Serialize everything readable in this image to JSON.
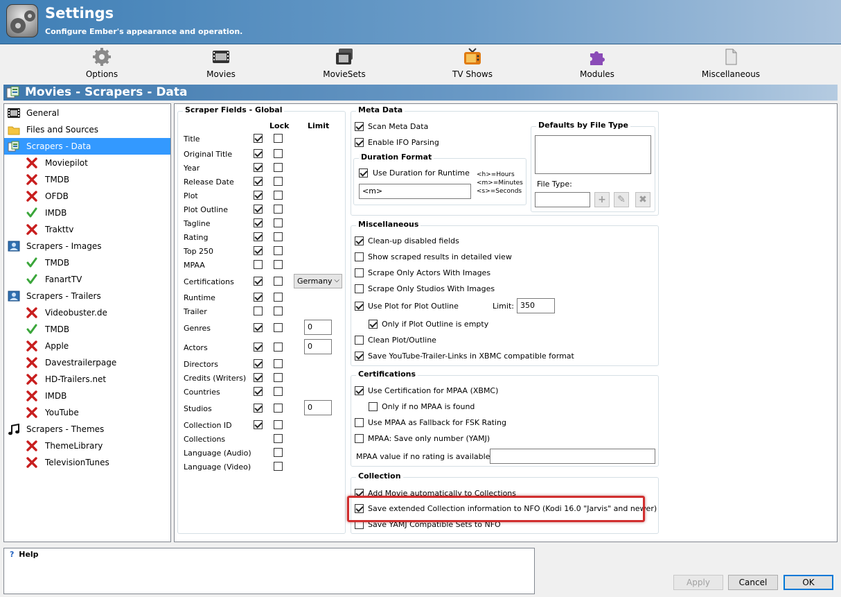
{
  "header": {
    "title": "Settings",
    "subtitle": "Configure Ember's appearance and operation."
  },
  "toolbar": {
    "buttons": [
      {
        "label": "Options",
        "icon": "gear-icon"
      },
      {
        "label": "Movies",
        "icon": "film-icon"
      },
      {
        "label": "MovieSets",
        "icon": "film-stack-icon"
      },
      {
        "label": "TV Shows",
        "icon": "tv-icon"
      },
      {
        "label": "Modules",
        "icon": "puzzle-icon"
      },
      {
        "label": "Miscellaneous",
        "icon": "document-icon"
      }
    ]
  },
  "section": {
    "title": "Movies - Scrapers - Data"
  },
  "tree": {
    "items": [
      {
        "label": "General",
        "icon": "film-icon",
        "indent": 0
      },
      {
        "label": "Files and Sources",
        "icon": "folder-icon",
        "indent": 0
      },
      {
        "label": "Scrapers - Data",
        "icon": "data-scraper-icon",
        "indent": 0,
        "selected": true
      },
      {
        "label": "Moviepilot",
        "icon": "disabled-x-icon",
        "indent": 1
      },
      {
        "label": "TMDB",
        "icon": "disabled-x-icon",
        "indent": 1
      },
      {
        "label": "OFDB",
        "icon": "disabled-x-icon",
        "indent": 1
      },
      {
        "label": "IMDB",
        "icon": "enabled-check-icon",
        "indent": 1
      },
      {
        "label": "Trakttv",
        "icon": "disabled-x-icon",
        "indent": 1
      },
      {
        "label": "Scrapers - Images",
        "icon": "image-scraper-icon",
        "indent": 0
      },
      {
        "label": "TMDB",
        "icon": "enabled-check-icon",
        "indent": 1
      },
      {
        "label": "FanartTV",
        "icon": "enabled-check-icon",
        "indent": 1
      },
      {
        "label": "Scrapers - Trailers",
        "icon": "image-scraper-icon",
        "indent": 0
      },
      {
        "label": "Videobuster.de",
        "icon": "disabled-x-icon",
        "indent": 1
      },
      {
        "label": "TMDB",
        "icon": "enabled-check-icon",
        "indent": 1
      },
      {
        "label": "Apple",
        "icon": "disabled-x-icon",
        "indent": 1
      },
      {
        "label": "Davestrailerpage",
        "icon": "disabled-x-icon",
        "indent": 1
      },
      {
        "label": "HD-Trailers.net",
        "icon": "disabled-x-icon",
        "indent": 1
      },
      {
        "label": "IMDB",
        "icon": "disabled-x-icon",
        "indent": 1
      },
      {
        "label": "YouTube",
        "icon": "disabled-x-icon",
        "indent": 1
      },
      {
        "label": "Scrapers - Themes",
        "icon": "music-note-icon",
        "indent": 0
      },
      {
        "label": "ThemeLibrary",
        "icon": "disabled-x-icon",
        "indent": 1
      },
      {
        "label": "TelevisionTunes",
        "icon": "disabled-x-icon",
        "indent": 1
      }
    ]
  },
  "scraper_fields": {
    "title": "Scraper Fields - Global",
    "col_lock": "Lock",
    "col_limit": "Limit",
    "rows": [
      {
        "label": "Title",
        "checked": true,
        "lock": false
      },
      {
        "label": "Original Title",
        "checked": true,
        "lock": false
      },
      {
        "label": "Year",
        "checked": true,
        "lock": false
      },
      {
        "label": "Release Date",
        "checked": true,
        "lock": false
      },
      {
        "label": "Plot",
        "checked": true,
        "lock": false
      },
      {
        "label": "Plot Outline",
        "checked": true,
        "lock": false
      },
      {
        "label": "Tagline",
        "checked": true,
        "lock": false
      },
      {
        "label": "Rating",
        "checked": true,
        "lock": false
      },
      {
        "label": "Top 250",
        "checked": true,
        "lock": false
      },
      {
        "label": "MPAA",
        "checked": false,
        "lock": false
      },
      {
        "label": "Certifications",
        "checked": true,
        "lock": false,
        "limit_select": "Germany"
      },
      {
        "label": "Runtime",
        "checked": true,
        "lock": false
      },
      {
        "label": "Trailer",
        "checked": false,
        "lock": false
      },
      {
        "label": "Genres",
        "checked": true,
        "lock": false,
        "limit_value": "0"
      },
      {
        "label": "Actors",
        "checked": true,
        "lock": false,
        "limit_value": "0"
      },
      {
        "label": "Directors",
        "checked": true,
        "lock": false
      },
      {
        "label": "Credits (Writers)",
        "checked": true,
        "lock": false
      },
      {
        "label": "Countries",
        "checked": true,
        "lock": false
      },
      {
        "label": "Studios",
        "checked": true,
        "lock": false,
        "limit_value": "0"
      },
      {
        "label": "Collection ID",
        "checked": true,
        "lock": false
      },
      {
        "label": "Collections",
        "checked": null,
        "lock": false
      },
      {
        "label": "Language (Audio)",
        "checked": null,
        "lock": false
      },
      {
        "label": "Language (Video)",
        "checked": null,
        "lock": false
      }
    ]
  },
  "meta_data": {
    "title": "Meta Data",
    "scan_meta_data": {
      "label": "Scan Meta Data",
      "checked": true
    },
    "enable_ifo": {
      "label": "Enable IFO Parsing",
      "checked": true
    },
    "duration_format": {
      "title": "Duration Format",
      "use_duration": {
        "label": "Use Duration for Runtime",
        "checked": true
      },
      "value": "<m>",
      "hint_hours": "<h>=Hours",
      "hint_minutes": "<m>=Minutes",
      "hint_seconds": "<s>=Seconds"
    },
    "defaults_by_file_type": {
      "title": "Defaults by File Type",
      "file_type_label": "File Type:",
      "file_type_value": ""
    }
  },
  "miscellaneous": {
    "title": "Miscellaneous",
    "items": [
      {
        "label": "Clean-up disabled fields",
        "checked": true
      },
      {
        "label": "Show scraped results in detailed view",
        "checked": false
      },
      {
        "label": "Scrape Only Actors With Images",
        "checked": false
      },
      {
        "label": "Scrape Only Studios With Images",
        "checked": false
      },
      {
        "label": "Use Plot for Plot Outline",
        "checked": true
      },
      {
        "label": "Only if Plot Outline is empty",
        "checked": true
      },
      {
        "label": "Clean Plot/Outline",
        "checked": false
      },
      {
        "label": "Save YouTube-Trailer-Links in XBMC compatible format",
        "checked": true
      }
    ],
    "limit_label": "Limit:",
    "limit_value": "350"
  },
  "certifications": {
    "title": "Certifications",
    "items": [
      {
        "label": "Use Certification for MPAA (XBMC)",
        "checked": true
      },
      {
        "label": "Only if no MPAA is found",
        "checked": false
      },
      {
        "label": "Use MPAA as Fallback for FSK Rating",
        "checked": false
      },
      {
        "label": "MPAA: Save only number (YAMJ)",
        "checked": false
      }
    ],
    "mpaa_value_label": "MPAA value if no rating is available:",
    "mpaa_value": ""
  },
  "collection": {
    "title": "Collection",
    "items": [
      {
        "label": "Add Movie automatically to Collections",
        "checked": true
      },
      {
        "label": "Save extended Collection information to NFO (Kodi 16.0 \"Jarvis\" and newer)",
        "checked": true
      },
      {
        "label": "Save YAMJ Compatible Sets to NFO",
        "checked": false
      }
    ]
  },
  "help": {
    "title": "Help",
    "icon": "question-icon"
  },
  "buttons": {
    "apply": "Apply",
    "cancel": "Cancel",
    "ok": "OK"
  },
  "colors": {
    "selection": "#3399ff",
    "header_start": "#3f7fb6",
    "highlight": "#d12e2e"
  }
}
